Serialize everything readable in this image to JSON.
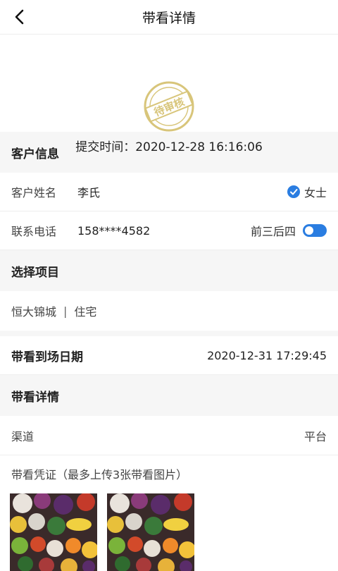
{
  "header": {
    "title": "带看详情"
  },
  "status": {
    "stamp_text": "待审核",
    "submit_label": "提交时间：",
    "submit_time": "2020-12-28 16:16:06"
  },
  "customer": {
    "section_title": "客户信息",
    "name_label": "客户姓名",
    "name_value": "李氏",
    "gender_value": "女士",
    "phone_label": "联系电话",
    "phone_value": "158****4582",
    "phone_mode_label": "前三后四"
  },
  "project": {
    "section_title": "选择项目",
    "name": "恒大锦城",
    "type": "住宅",
    "separator": "|"
  },
  "visit": {
    "date_label": "带看到场日期",
    "date_value": "2020-12-31 17:29:45"
  },
  "details": {
    "section_title": "带看详情",
    "channel_label": "渠道",
    "channel_value": "平台",
    "proof_label": "带看凭证（最多上传3张带看图片）"
  },
  "colors": {
    "accent": "#2a7de1",
    "stamp": "#d8c57a"
  }
}
